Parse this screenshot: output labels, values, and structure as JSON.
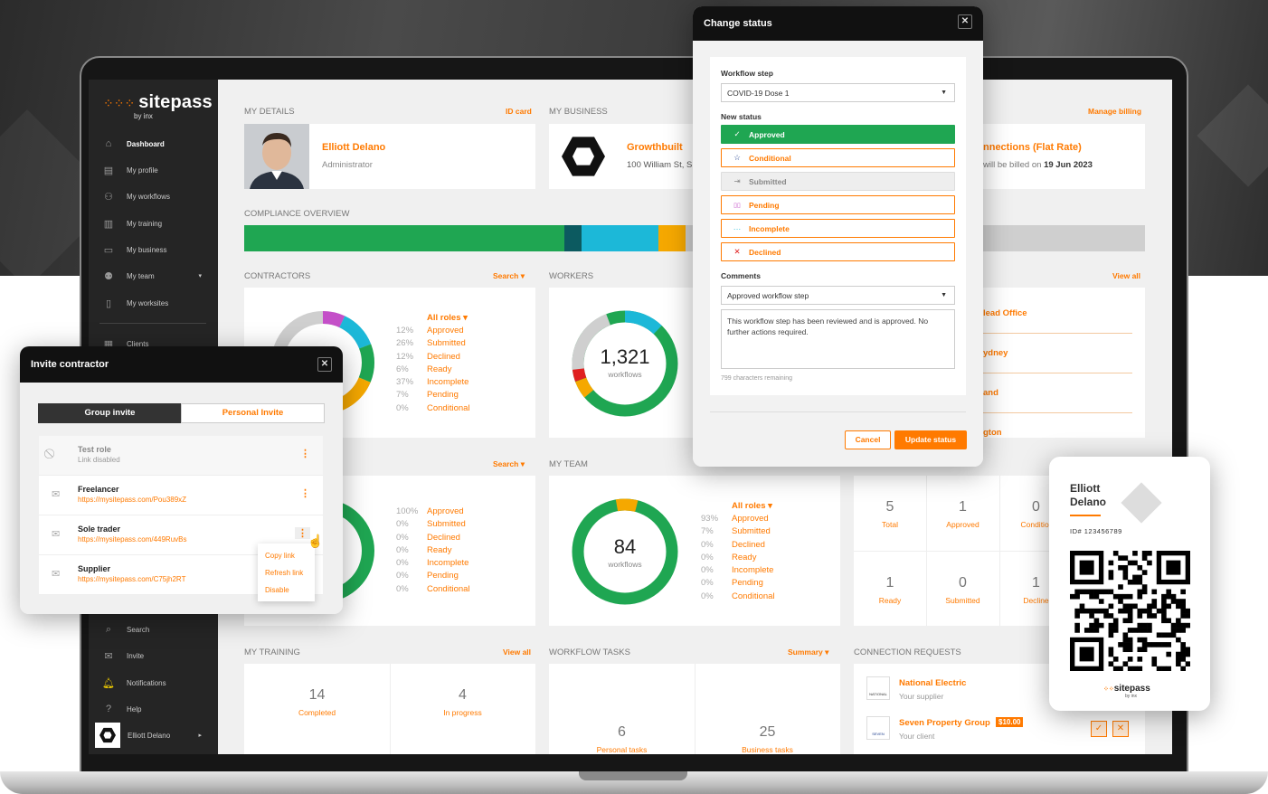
{
  "sidebar": {
    "brand": "sitepass",
    "by": "by inx",
    "items": [
      {
        "label": "Dashboard",
        "icon": "home-icon"
      },
      {
        "label": "My profile",
        "icon": "id-card-icon"
      },
      {
        "label": "My workflows",
        "icon": "workflow-icon"
      },
      {
        "label": "My training",
        "icon": "books-icon"
      },
      {
        "label": "My business",
        "icon": "briefcase-icon"
      },
      {
        "label": "My team",
        "icon": "team-icon"
      },
      {
        "label": "My worksites",
        "icon": "map-icon"
      },
      {
        "label": "Clients",
        "icon": "clients-icon"
      }
    ],
    "bottom": [
      {
        "label": "Search",
        "icon": "search-icon"
      },
      {
        "label": "Invite",
        "icon": "mail-icon"
      },
      {
        "label": "Notifications",
        "icon": "bell-icon"
      },
      {
        "label": "Help",
        "icon": "help-icon"
      }
    ],
    "user": "Elliott Delano"
  },
  "my_details": {
    "title": "MY DETAILS",
    "link": "ID card",
    "name": "Elliott Delano",
    "role": "Administrator"
  },
  "my_business": {
    "title": "MY BUSINESS",
    "name": "Growthbuilt",
    "address": "100 William St, S"
  },
  "billing": {
    "link": "Manage billing",
    "plan": "nnections (Flat Rate)",
    "note_prefix": "will be billed on",
    "date": "19 Jun 2023"
  },
  "compliance": {
    "title": "COMPLIANCE OVERVIEW",
    "segments": [
      {
        "color": "#1fa652",
        "pct": 0.355
      },
      {
        "color": "#0c5a60",
        "pct": 0.02
      },
      {
        "color": "#1cb8d8",
        "pct": 0.085
      },
      {
        "color": "#f5a800",
        "pct": 0.03
      },
      {
        "color": "#cfcfcf",
        "pct": 0.51
      }
    ]
  },
  "contractors": {
    "title": "CONTRACTORS",
    "link": "Search",
    "filter": "All roles",
    "rows": [
      {
        "p": "12%",
        "l": "Approved"
      },
      {
        "p": "26%",
        "l": "Submitted"
      },
      {
        "p": "12%",
        "l": "Declined"
      },
      {
        "p": "6%",
        "l": "Ready"
      },
      {
        "p": "37%",
        "l": "Incomplete"
      },
      {
        "p": "7%",
        "l": "Pending"
      },
      {
        "p": "0%",
        "l": "Conditional"
      }
    ]
  },
  "workers": {
    "title": "WORKERS",
    "count": "1,321",
    "unit": "workflows"
  },
  "worksites": {
    "link": "View all",
    "items": [
      "lead Office",
      "ydney",
      "and",
      "gton"
    ]
  },
  "second_left": {
    "link": "Search",
    "rows": [
      {
        "p": "100%",
        "l": "Approved"
      },
      {
        "p": "0%",
        "l": "Submitted"
      },
      {
        "p": "0%",
        "l": "Declined"
      },
      {
        "p": "0%",
        "l": "Ready"
      },
      {
        "p": "0%",
        "l": "Incomplete"
      },
      {
        "p": "0%",
        "l": "Pending"
      },
      {
        "p": "0%",
        "l": "Conditional"
      }
    ]
  },
  "my_team": {
    "title": "MY TEAM",
    "count": "84",
    "unit": "workflows",
    "filter": "All roles",
    "rows": [
      {
        "p": "93%",
        "l": "Approved"
      },
      {
        "p": "7%",
        "l": "Submitted"
      },
      {
        "p": "0%",
        "l": "Declined"
      },
      {
        "p": "0%",
        "l": "Ready"
      },
      {
        "p": "0%",
        "l": "Incomplete"
      },
      {
        "p": "0%",
        "l": "Pending"
      },
      {
        "p": "0%",
        "l": "Conditional"
      }
    ]
  },
  "stats": [
    {
      "n": "5",
      "l": "Total"
    },
    {
      "n": "1",
      "l": "Approved"
    },
    {
      "n": "0",
      "l": "Conditior"
    },
    {
      "n": "1",
      "l": "Ready"
    },
    {
      "n": "0",
      "l": "Submitted"
    },
    {
      "n": "1",
      "l": "Decline"
    }
  ],
  "my_training": {
    "title": "MY TRAINING",
    "link": "View all",
    "items": [
      {
        "n": "14",
        "l": "Completed"
      },
      {
        "n": "4",
        "l": "In progress"
      }
    ]
  },
  "workflow_tasks": {
    "title": "WORKFLOW TASKS",
    "link": "Summary",
    "items": [
      {
        "n": "6",
        "l": "Personal tasks"
      },
      {
        "n": "25",
        "l": "Business tasks"
      }
    ]
  },
  "connection_requests": {
    "title": "CONNECTION REQUESTS",
    "items": [
      {
        "name": "National Electric",
        "sub": "Your supplier",
        "logo": "NATIONAL"
      },
      {
        "name": "Seven Property Group",
        "sub": "Your client",
        "badge": "$10.00",
        "logo": "SEVEN"
      }
    ]
  },
  "change_status": {
    "title": "Change status",
    "workflow_label": "Workflow step",
    "workflow_value": "COVID-19 Dose 1",
    "status_label": "New status",
    "statuses": [
      {
        "l": "Approved",
        "icon": "check-icon",
        "g": "✓"
      },
      {
        "l": "Conditional",
        "icon": "star-icon",
        "g": "☆"
      },
      {
        "l": "Submitted",
        "icon": "submit-icon",
        "g": "⇥"
      },
      {
        "l": "Pending",
        "icon": "pause-icon",
        "g": "▯▯"
      },
      {
        "l": "Incomplete",
        "icon": "dots-icon",
        "g": "···"
      },
      {
        "l": "Declined",
        "icon": "x-icon",
        "g": "✕"
      }
    ],
    "comments_label": "Comments",
    "comment_template": "Approved workflow step",
    "comment_text": "This workflow step has been reviewed and is approved.  No further actions required.",
    "remaining": "799 characters remaining",
    "cancel": "Cancel",
    "update": "Update status"
  },
  "invite": {
    "title": "Invite contractor",
    "tab_group": "Group invite",
    "tab_personal": "Personal Invite",
    "rows": [
      {
        "t": "Test role",
        "u": "Link disabled",
        "disabled": true
      },
      {
        "t": "Freelancer",
        "u": "https://mysitepass.com/Pou389xZ"
      },
      {
        "t": "Sole trader",
        "u": "https://mysitepass.com/449RuvBs"
      },
      {
        "t": "Supplier",
        "u": "https://mysitepass.com/C75jh2RT"
      }
    ],
    "menu": [
      "Copy link",
      "Refresh link",
      "Disable"
    ]
  },
  "id_card": {
    "first": "Elliott",
    "last": "Delano",
    "id": "ID# 123456789",
    "brand": "sitepass",
    "by": "by inx"
  }
}
